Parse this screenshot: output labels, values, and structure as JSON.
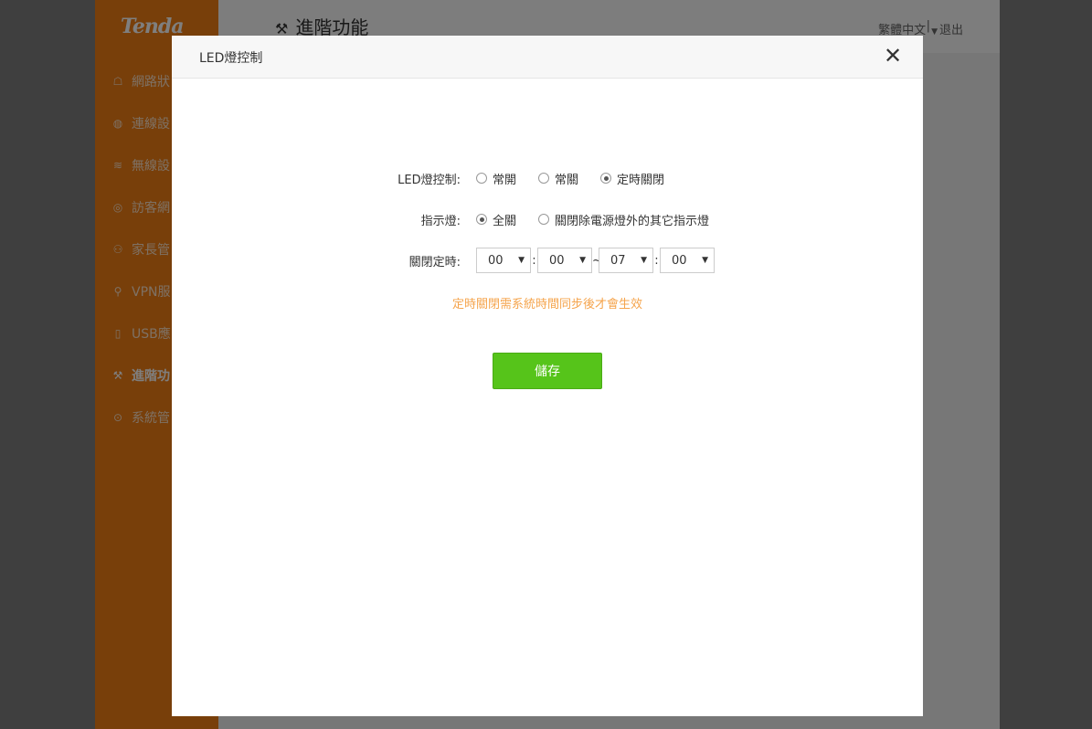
{
  "app": {
    "logo": "Tenda",
    "page_title": "進階功能",
    "language": "繁體中文",
    "separator": "|",
    "logout": "退出"
  },
  "sidebar": {
    "items": [
      {
        "label": "網路狀",
        "icon": "router-icon",
        "glyph": "☖"
      },
      {
        "label": "連線設",
        "icon": "globe-icon",
        "glyph": "◍"
      },
      {
        "label": "無線設",
        "icon": "wifi-icon",
        "glyph": "≋"
      },
      {
        "label": "訪客網",
        "icon": "guest-icon",
        "glyph": "◎"
      },
      {
        "label": "家長管",
        "icon": "family-icon",
        "glyph": "⚇"
      },
      {
        "label": "VPN服",
        "icon": "vpn-icon",
        "glyph": "⚲"
      },
      {
        "label": "USB應",
        "icon": "usb-icon",
        "glyph": "▯"
      },
      {
        "label": "進階功",
        "icon": "wrench-icon",
        "glyph": "⚒",
        "active": true
      },
      {
        "label": "系統管",
        "icon": "settings-icon",
        "glyph": "⊙"
      }
    ]
  },
  "modal": {
    "title": "LED燈控制",
    "close_glyph": "✕",
    "led_control": {
      "label": "LED燈控制:",
      "options": [
        "常開",
        "常關",
        "定時關閉"
      ],
      "selected": 2
    },
    "indicator": {
      "label": "指示燈:",
      "options": [
        "全關",
        "關閉除電源燈外的其它指示燈"
      ],
      "selected": 0
    },
    "schedule": {
      "label": "關閉定時:",
      "start_hour": "00",
      "start_minute": "00",
      "end_hour": "07",
      "end_minute": "00",
      "colon": ":",
      "tilde": "~"
    },
    "tip": "定時關閉需系統時間同步後才會生效",
    "save_label": "儲存"
  },
  "colors": {
    "sidebar": "#f07e14",
    "save_button": "#56c41a",
    "tip_text": "#f5a44c"
  }
}
